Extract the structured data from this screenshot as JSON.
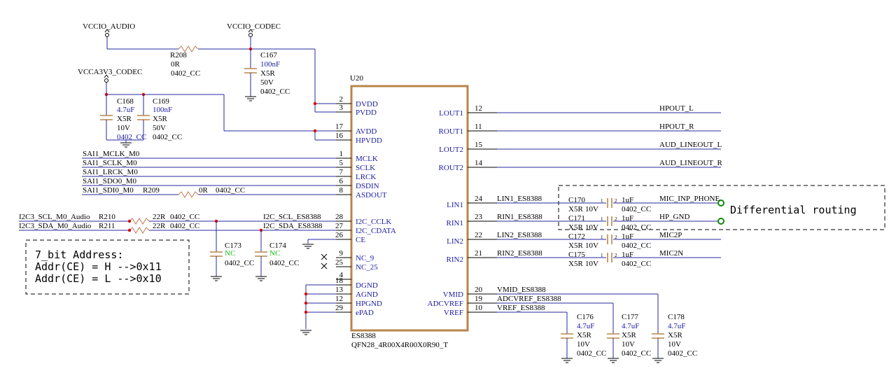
{
  "power_labels": {
    "vccio_audio": "VCCIO_AUDIO",
    "vccio_codec": "VCCIO_CODEC",
    "vcca3v3_codec": "VCCA3V3_CODEC"
  },
  "chip": {
    "ref": "U20",
    "name": "ES8388",
    "package": "QFN28_4R00X4R00X0R90_T",
    "left_pins": [
      {
        "num": "2",
        "name": "DVDD"
      },
      {
        "num": "3",
        "name": "PVDD"
      },
      {
        "num": "17",
        "name": "AVDD"
      },
      {
        "num": "16",
        "name": "HPVDD"
      },
      {
        "num": "1",
        "name": "MCLK"
      },
      {
        "num": "5",
        "name": "SCLK"
      },
      {
        "num": "7",
        "name": "LRCK"
      },
      {
        "num": "6",
        "name": "DSDIN"
      },
      {
        "num": "8",
        "name": "ASDOUT"
      },
      {
        "num": "28",
        "name": "I2C_CCLK"
      },
      {
        "num": "27",
        "name": "I2C_CDATA"
      },
      {
        "num": "26",
        "name": "CE"
      },
      {
        "num": "9",
        "name": "NC_9"
      },
      {
        "num": "25",
        "name": "NC_25"
      },
      {
        "num": "4",
        "name": ""
      },
      {
        "num": "18",
        "name": "DGND"
      },
      {
        "num": "13",
        "name": "AGND"
      },
      {
        "num": "12",
        "name": "HPGND"
      },
      {
        "num": "29",
        "name": "ePAD"
      }
    ],
    "right_pins": [
      {
        "num": "12",
        "name": "LOUT1"
      },
      {
        "num": "11",
        "name": "ROUT1"
      },
      {
        "num": "15",
        "name": "LOUT2"
      },
      {
        "num": "14",
        "name": "ROUT2"
      },
      {
        "num": "24",
        "name": "LIN1"
      },
      {
        "num": "23",
        "name": "RIN1"
      },
      {
        "num": "22",
        "name": "LIN2"
      },
      {
        "num": "21",
        "name": "RIN2"
      },
      {
        "num": "20",
        "name": "VMID"
      },
      {
        "num": "19",
        "name": "ADCVREF"
      },
      {
        "num": "10",
        "name": "VREF"
      }
    ]
  },
  "nets": {
    "hpout_l": "HPOUT_L",
    "hpout_r": "HPOUT_R",
    "aud_lineout_l": "AUD_LINEOUT_L",
    "aud_lineout_r": "AUD_LINEOUT_R",
    "sai_mclk": "SAI1_MCLK_M0",
    "sai_sclk": "SAI1_SCLK_M0",
    "sai_lrck": "SAI1_LRCK_M0",
    "sai_sdo0": "SAI1_SDO0_M0",
    "sai_sdi0": "SAI1_SDI0_M0",
    "i2c_scl_in": "I2C3_SCL_M0_Audio",
    "i2c_sda_in": "I2C3_SDA_M0_Audio",
    "i2c_scl": "I2C_SCL_ES8388",
    "i2c_sda": "I2C_SDA_ES8388",
    "lin1": "LIN1_ES8388",
    "rin1": "RIN1_ES8388",
    "lin2": "LIN2_ES8388",
    "rin2": "RIN2_ES8388",
    "mic_inp": "MIC_INP_PHONE",
    "hp_gnd": "HP_GND",
    "mic2p": "MIC2P",
    "mic2n": "MIC2N",
    "vmid": "VMID_ES8388",
    "adcvref": "ADCVREF_ES8388",
    "vref": "VREF_ES8388"
  },
  "resistors": {
    "r208": {
      "ref": "R208",
      "value": "0R",
      "pkg": "0402_CC"
    },
    "r209": {
      "ref": "R209",
      "value": "0R",
      "pkg": "0402_CC"
    },
    "r210": {
      "ref": "R210",
      "value": "22R",
      "pkg": "0402_CC"
    },
    "r211": {
      "ref": "R211",
      "value": "22R",
      "pkg": "0402_CC"
    }
  },
  "capacitors": {
    "c167": {
      "ref": "C167",
      "value": "100nF",
      "diel": "X5R",
      "volt": "50V",
      "pkg": "0402_CC"
    },
    "c168": {
      "ref": "C168",
      "value": "4.7uF",
      "diel": "X5R",
      "volt": "10V",
      "pkg": "0402_CC"
    },
    "c169": {
      "ref": "C169",
      "value": "100nF",
      "diel": "X5R",
      "volt": "50V",
      "pkg": "0402_CC"
    },
    "c173": {
      "ref": "C173",
      "value": "NC",
      "pkg": "0402_CC"
    },
    "c174": {
      "ref": "C174",
      "value": "NC",
      "pkg": "0402_CC"
    },
    "c170": {
      "ref": "C170",
      "value": "1uF",
      "diel": "X5R",
      "volt": "10V",
      "pkg": "0402_CC"
    },
    "c171": {
      "ref": "C171",
      "value": "1uF",
      "diel": "X5R",
      "volt": "10V",
      "pkg": "0402_CC"
    },
    "c172": {
      "ref": "C172",
      "value": "1uF",
      "diel": "X5R",
      "volt": "10V",
      "pkg": "0402_CC"
    },
    "c175": {
      "ref": "C175",
      "value": "1uF",
      "diel": "X5R",
      "volt": "10V",
      "pkg": "0402_CC"
    },
    "c176": {
      "ref": "C176",
      "value": "4.7uF",
      "diel": "X5R",
      "volt": "10V",
      "pkg": "0402_CC"
    },
    "c177": {
      "ref": "C177",
      "value": "4.7uF",
      "diel": "X5R",
      "volt": "10V",
      "pkg": "0402_CC"
    },
    "c178": {
      "ref": "C178",
      "value": "4.7uF",
      "diel": "X5R",
      "volt": "10V",
      "pkg": "0402_CC"
    }
  },
  "pin_marks": {
    "one": "1",
    "two": "2"
  },
  "notes": {
    "address_title": "7_bit Address:",
    "address_h": "Addr(CE) = H -->0x11",
    "address_l": "Addr(CE) = L -->0x10",
    "differential": "Differential routing"
  }
}
